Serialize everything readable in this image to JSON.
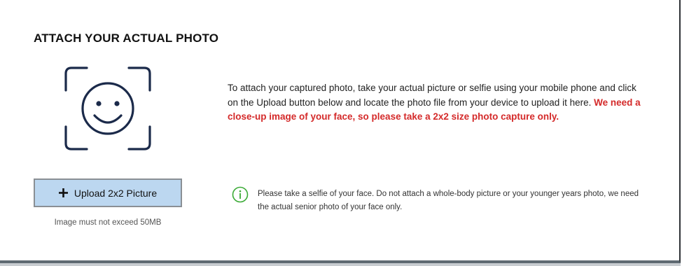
{
  "section": {
    "title": "ATTACH YOUR ACTUAL PHOTO"
  },
  "instructions": {
    "body": "To attach your captured photo, take your actual picture or selfie using your mobile phone and click on the Upload button below and locate the photo file from your device to upload it here. ",
    "warning": "We need a close-up image of your face, so please take a 2x2 size photo capture only."
  },
  "upload": {
    "button_label": "Upload 2x2 Picture",
    "size_note": "Image must not exceed 50MB"
  },
  "notice": {
    "text": "Please take a selfie of your face.  Do not attach a whole-body picture or your younger years photo, we need the actual senior photo of your face only."
  },
  "icons": {
    "face_scan": "face-scan-icon",
    "plus": "plus-icon",
    "info": "info-icon"
  },
  "colors": {
    "warning_text": "#d42a2a",
    "upload_button_bg": "#bcd7f0",
    "info_icon": "#3aaa35",
    "face_icon": "#1b2a4a"
  }
}
